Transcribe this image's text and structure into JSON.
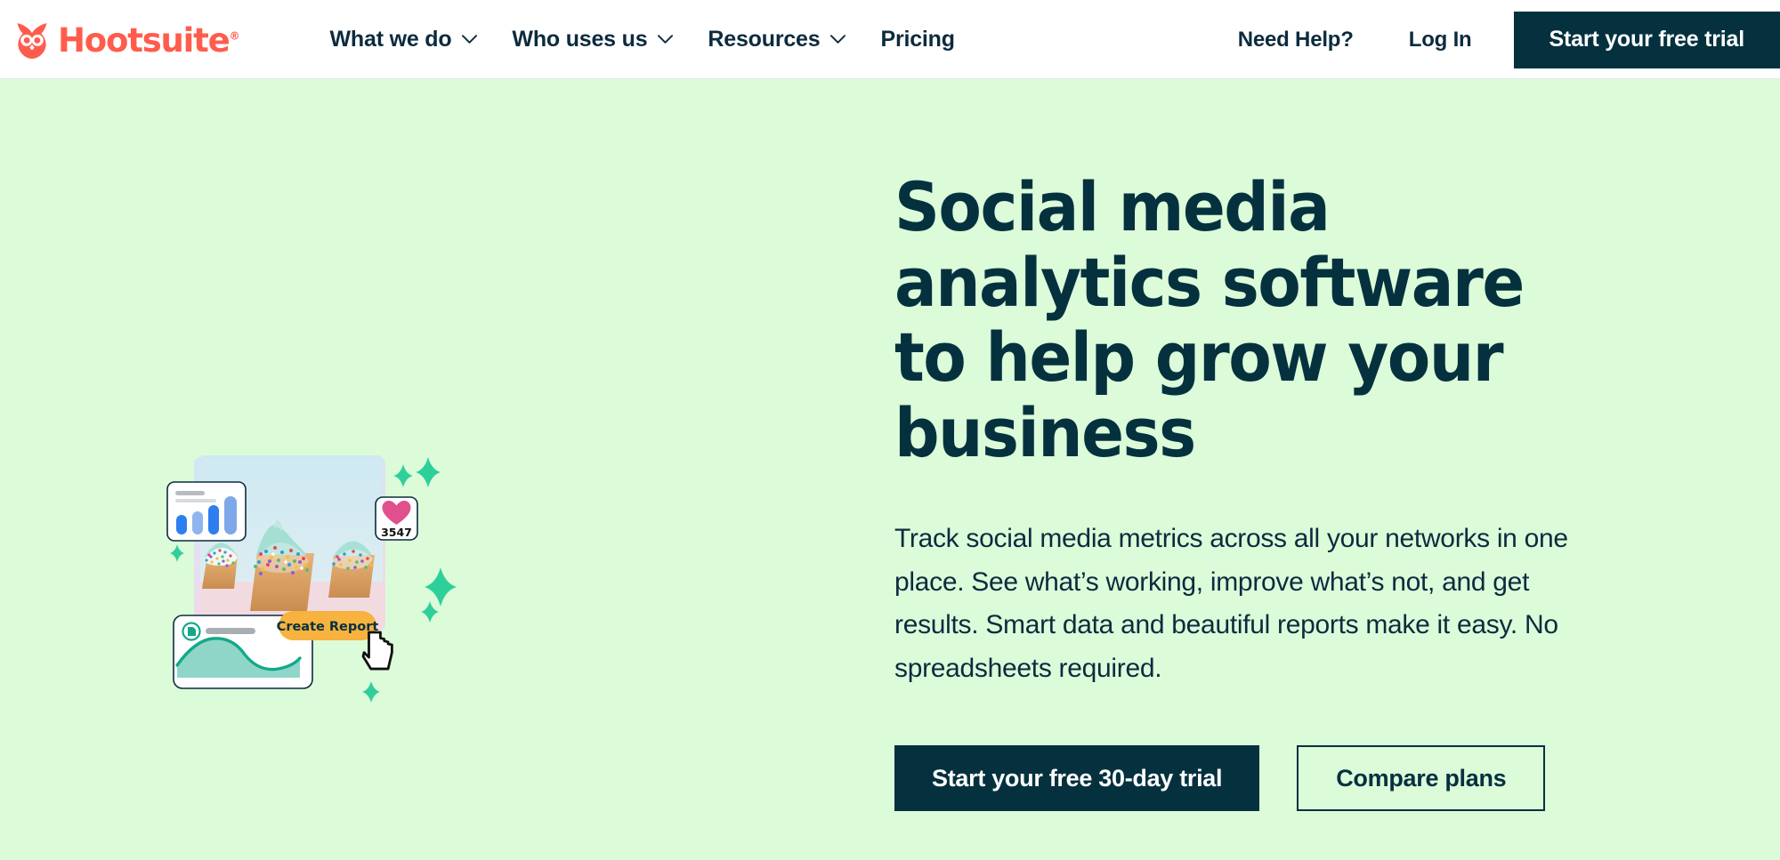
{
  "brand": {
    "name": "Hootsuite",
    "registered_mark": "®",
    "logo_color": "#ff5c4d",
    "ink_color": "#05313f",
    "hero_bg_color": "#dcfbd9",
    "accent_orange": "#f7b23f",
    "accent_green": "#2fcf99",
    "accent_pink": "#e0508d",
    "owl_icon": "owl-icon"
  },
  "nav": {
    "items": [
      {
        "label": "What we do",
        "has_dropdown": true,
        "icon": "chevron-down-icon"
      },
      {
        "label": "Who uses us",
        "has_dropdown": true,
        "icon": "chevron-down-icon"
      },
      {
        "label": "Resources",
        "has_dropdown": true,
        "icon": "chevron-down-icon"
      },
      {
        "label": "Pricing",
        "has_dropdown": false,
        "icon": ""
      }
    ],
    "help_label": "Need Help?",
    "login_label": "Log In",
    "trial_label": "Start your free trial"
  },
  "hero": {
    "title": "Social media analytics software to help grow your business",
    "body": "Track social media metrics across all your networks in one place. See what’s working, improve what’s not, and get results. Smart data and beautiful reports make it easy. No spreadsheets required.",
    "primary_cta": "Start your free 30-day trial",
    "secondary_cta": "Compare plans"
  },
  "illustration": {
    "photo_alt": "cupcakes-photo",
    "bar_card": {
      "icon": "bar-chart-icon",
      "bars": [
        42,
        52,
        66,
        86
      ],
      "bar_colors": [
        "#2f7ef0",
        "#8fb4ef",
        "#2f7ef0",
        "#7fa8e8"
      ]
    },
    "like_badge": {
      "icon": "heart-icon",
      "count": "3547"
    },
    "report_card": {
      "icon": "document-icon",
      "area_values": [
        20,
        54,
        74,
        80,
        70,
        48,
        36,
        32,
        38,
        46
      ],
      "line_color": "#14a88a",
      "fill_color": "#8fd6c8"
    },
    "create_report_button": "Create Report",
    "cursor_icon": "pointer-hand-icon",
    "sparkles": 6
  }
}
